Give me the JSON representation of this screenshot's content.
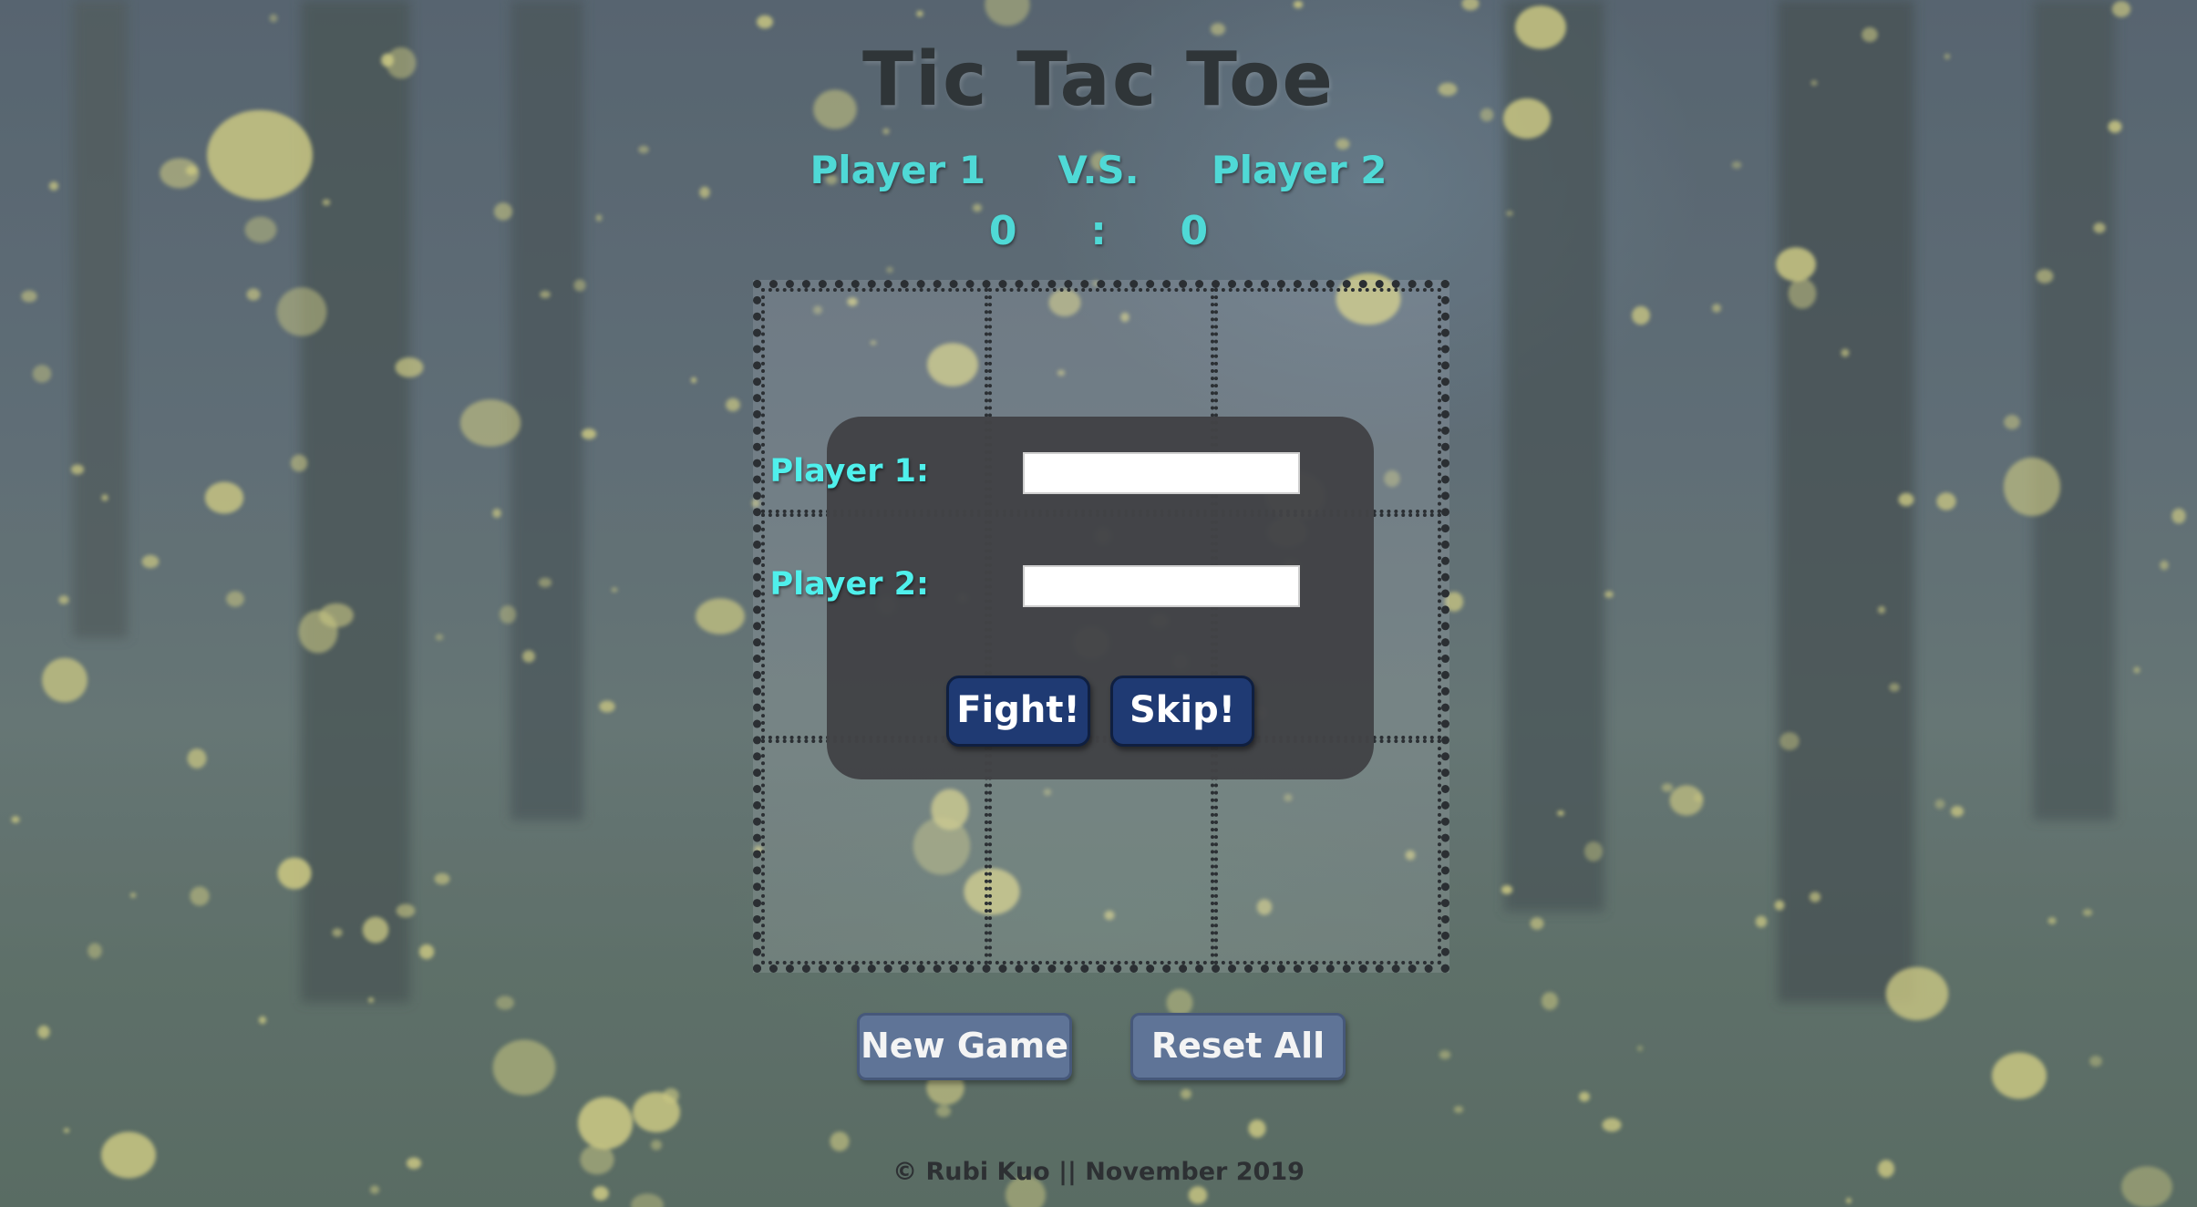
{
  "game": {
    "title": "Tic Tac Toe",
    "player1_name": "Player 1",
    "vs_label": "V.S.",
    "player2_name": "Player 2",
    "score1": "0",
    "score_separator": ":",
    "score2": "0"
  },
  "board": {
    "cells": [
      "",
      "",
      "",
      "",
      "",
      "",
      "",
      "",
      ""
    ]
  },
  "modal": {
    "player1_label": "Player 1:",
    "player1_value": "",
    "player2_label": "Player 2:",
    "player2_value": "",
    "fight_label": "Fight!",
    "skip_label": "Skip!"
  },
  "controls": {
    "new_game_label": "New Game",
    "reset_all_label": "Reset All"
  },
  "footer": {
    "text": "© Rubi Kuo || November 2019"
  },
  "colors": {
    "accent": "#4fd9d6",
    "modal_button": "#1f3a73",
    "action_button": "#5f7497"
  }
}
